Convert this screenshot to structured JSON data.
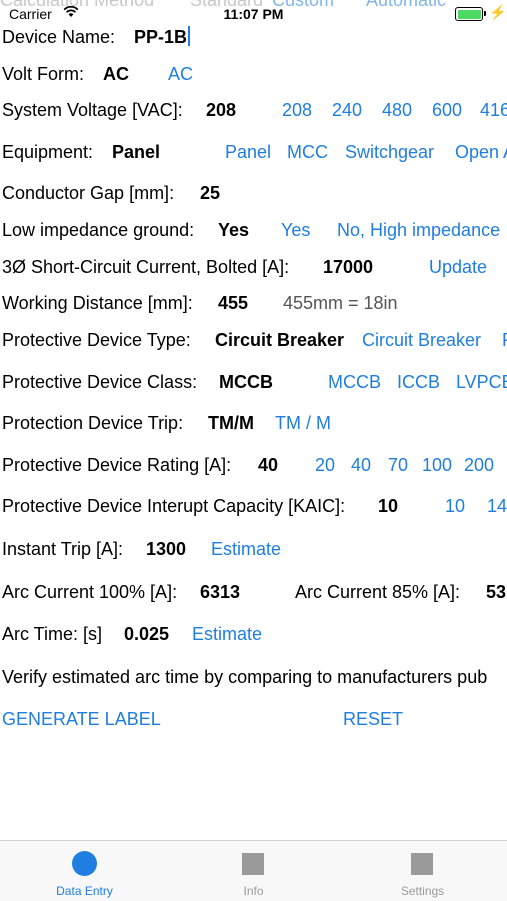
{
  "status_bar": {
    "carrier": "Carrier",
    "time": "11:07 PM"
  },
  "cutoff_row": {
    "label": "Calculation Method",
    "value": "Standard",
    "options": [
      "Custom",
      "Automatic"
    ]
  },
  "form": {
    "device_name": {
      "label": "Device Name:",
      "value": "PP-1B"
    },
    "volt_form": {
      "label": "Volt Form:",
      "value": "AC",
      "options": [
        "AC"
      ]
    },
    "system_voltage": {
      "label": "System Voltage [VAC]:",
      "value": "208",
      "options": [
        "208",
        "240",
        "480",
        "600",
        "416"
      ]
    },
    "equipment": {
      "label": "Equipment:",
      "value": "Panel",
      "options": [
        "Panel",
        "MCC",
        "Switchgear",
        "Open A"
      ]
    },
    "conductor_gap": {
      "label": "Conductor Gap [mm]:",
      "value": "25"
    },
    "low_impedance_ground": {
      "label": "Low impedance ground:",
      "value": "Yes",
      "options": [
        "Yes",
        "No, High impedance"
      ]
    },
    "short_circuit": {
      "label": "3Ø Short-Circuit Current, Bolted [A]:",
      "value": "17000",
      "action": "Update"
    },
    "working_distance": {
      "label": "Working Distance [mm]:",
      "value": "455",
      "hint": "455mm = 18in"
    },
    "device_type": {
      "label": "Protective Device Type:",
      "value": "Circuit Breaker",
      "options": [
        "Circuit Breaker",
        "F"
      ]
    },
    "device_class": {
      "label": "Protective Device Class:",
      "value": "MCCB",
      "options": [
        "MCCB",
        "ICCB",
        "LVPCB"
      ]
    },
    "device_trip": {
      "label": "Protection Device Trip:",
      "value": "TM/M",
      "options": [
        "TM / M"
      ]
    },
    "device_rating": {
      "label": "Protective Device Rating [A]:",
      "value": "40",
      "options": [
        "20",
        "40",
        "70",
        "100",
        "200"
      ]
    },
    "interrupt_capacity": {
      "label": "Protective Device Interupt Capacity [KAIC]:",
      "value": "10",
      "options": [
        "10",
        "14"
      ]
    },
    "instant_trip": {
      "label": "Instant Trip [A]:",
      "value": "1300",
      "action": "Estimate"
    },
    "arc_current": {
      "label": "Arc Current 100% [A]:",
      "value": "6313",
      "label_85": "Arc Current 85% [A]:",
      "value_85": "53"
    },
    "arc_time": {
      "label": "Arc Time: [s]",
      "value": "0.025",
      "action": "Estimate"
    },
    "verify_note": "Verify estimated arc time by comparing to manufacturers pub"
  },
  "actions": {
    "generate": "GENERATE LABEL",
    "reset": "RESET"
  },
  "tabs": [
    {
      "label": "Data Entry",
      "icon": "circle-icon",
      "active": true
    },
    {
      "label": "Info",
      "icon": "square-icon",
      "active": false
    },
    {
      "label": "Settings",
      "icon": "square-icon",
      "active": false
    }
  ],
  "colors": {
    "accent": "#1f7ee0",
    "battery": "#4cd964",
    "tab_inactive": "#9a9a9a"
  }
}
